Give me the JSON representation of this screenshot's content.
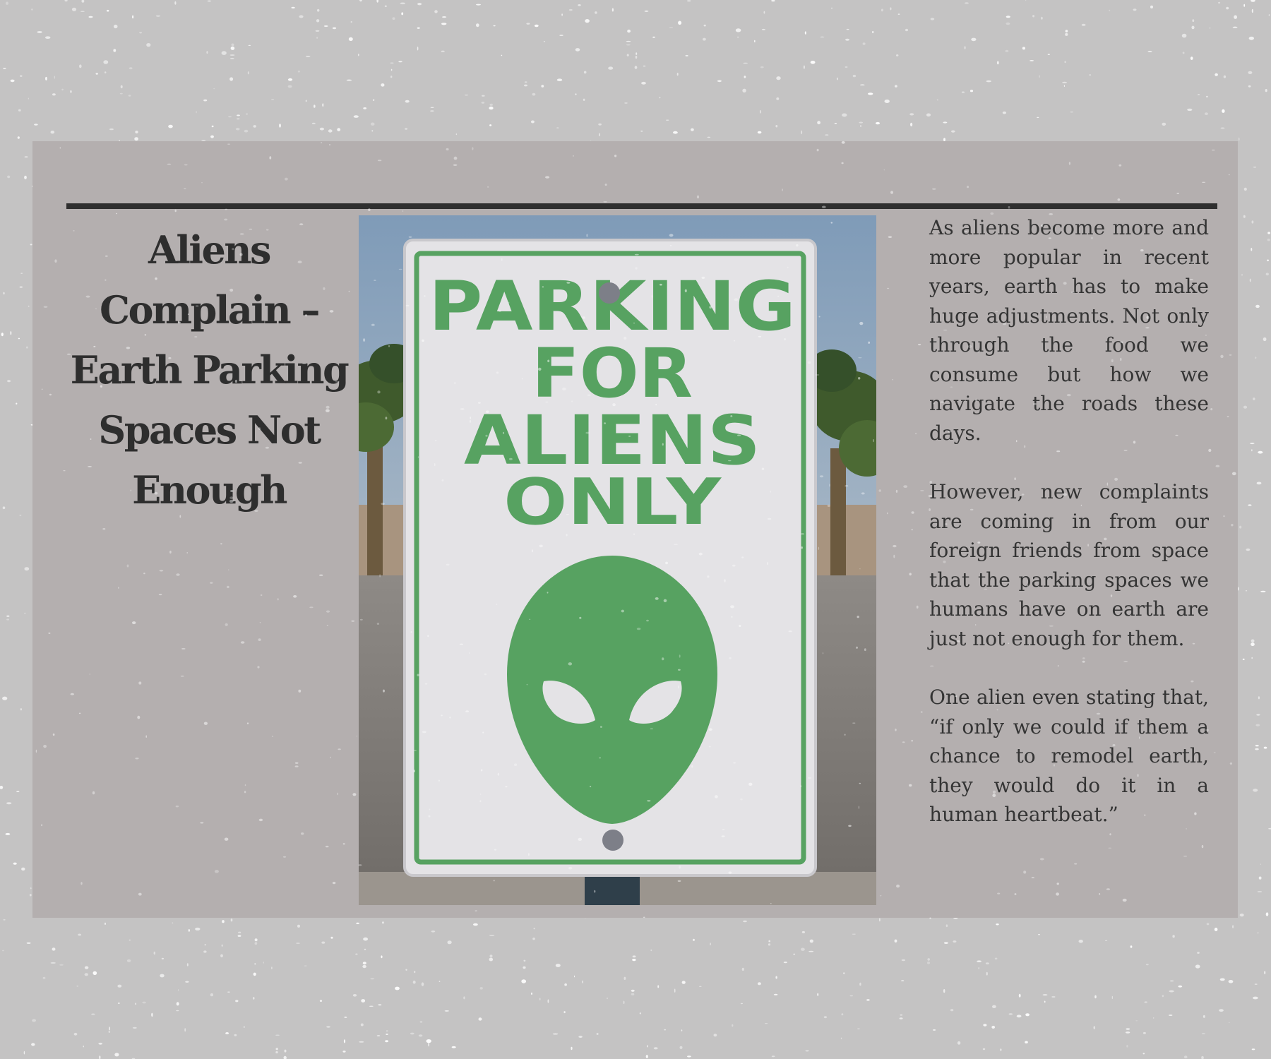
{
  "headline": "Aliens Complain – Earth Parking Spaces Not Enough",
  "paragraphs": [
    "As aliens become more and more popular in recent years, earth has to make huge adjustments. Not only through the food we consume but how we navigate the roads these days.",
    "However, new complaints are coming in from our foreign friends from space that the parking spaces we humans have on earth are just not enough for them.",
    "One alien even stating that, “if only we could if them a chance to remodel earth, they would do it in a human heartbeat.”"
  ],
  "sign": {
    "line1": "PARKING",
    "line2": "FOR",
    "line3": "ALIENS",
    "line4": "ONLY",
    "icon": "alien-head-icon"
  },
  "colors": {
    "background": "#c4c3c3",
    "panel": "#b4afaf",
    "sign_green": "#57a261",
    "text": "#2e2e2e"
  }
}
